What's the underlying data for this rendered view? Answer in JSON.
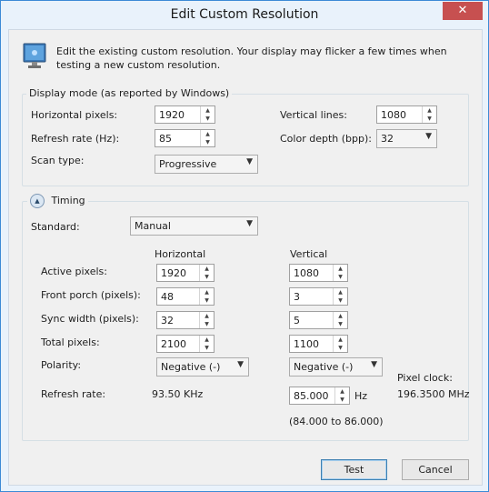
{
  "window": {
    "title": "Edit Custom Resolution",
    "close_glyph": "✕"
  },
  "intro": {
    "text": "Edit the existing custom resolution. Your display may flicker a few times when testing a new custom resolution."
  },
  "display_mode": {
    "legend": "Display mode (as reported by Windows)",
    "horizontal_pixels": {
      "label": "Horizontal pixels:",
      "value": "1920"
    },
    "vertical_lines": {
      "label": "Vertical lines:",
      "value": "1080"
    },
    "refresh_rate": {
      "label": "Refresh rate (Hz):",
      "value": "85"
    },
    "color_depth": {
      "label": "Color depth (bpp):",
      "value": "32"
    },
    "scan_type": {
      "label": "Scan type:",
      "value": "Progressive"
    }
  },
  "timing": {
    "legend": "Timing",
    "standard": {
      "label": "Standard:",
      "value": "Manual"
    },
    "col_horizontal": "Horizontal",
    "col_vertical": "Vertical",
    "rows": {
      "active": {
        "label": "Active pixels:",
        "h": "1920",
        "v": "1080"
      },
      "front_porch": {
        "label": "Front porch (pixels):",
        "h": "48",
        "v": "3"
      },
      "sync_width": {
        "label": "Sync width (pixels):",
        "h": "32",
        "v": "5"
      },
      "total": {
        "label": "Total pixels:",
        "h": "2100",
        "v": "1100"
      },
      "polarity": {
        "label": "Polarity:",
        "h": "Negative (-)",
        "v": "Negative (-)"
      }
    },
    "refresh": {
      "label": "Refresh rate:",
      "h_value": "93.50 KHz",
      "v_value": "85.000",
      "v_unit": "Hz",
      "range": "(84.000 to 86.000)"
    },
    "pixel_clock": {
      "label": "Pixel clock:",
      "value": "196.3500 MHz"
    }
  },
  "buttons": {
    "test": "Test",
    "cancel": "Cancel"
  },
  "icons": {
    "spin_up": "▲",
    "spin_down": "▼",
    "chevron": "▼",
    "collapse": "▲"
  },
  "colors": {
    "accent": "#3c8ad6",
    "close": "#c75050"
  }
}
